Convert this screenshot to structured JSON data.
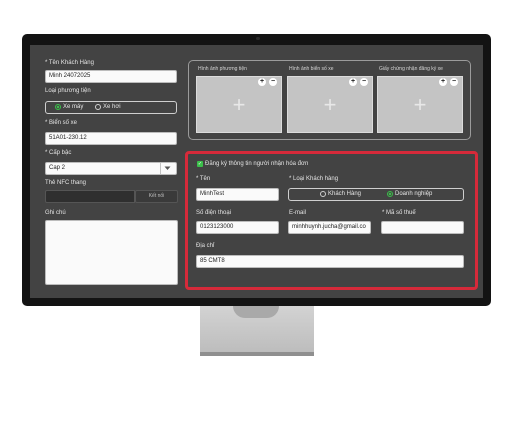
{
  "customer": {
    "name_label": "* Tên Khách Hàng",
    "name_value": "Minh 24072025",
    "vehicle_type_label": "Loại phương tiện",
    "vehicle_options": [
      {
        "label": "Xe máy",
        "selected": true
      },
      {
        "label": "Xe hơi",
        "selected": false
      }
    ],
    "plate_label": "* Biển số xe",
    "plate_value": "51A01-230.12",
    "level_label": "* Cấp bậc",
    "level_value": "Cap 2",
    "nfc_label": "Thẻ NFC thang",
    "connect_label": "Kết nối",
    "notes_label": "Ghi chú"
  },
  "images": [
    {
      "title": "Hình ảnh phương tiện"
    },
    {
      "title": "Hình ảnh biển số xe"
    },
    {
      "title": "Giấy chứng nhận đăng ký xe"
    }
  ],
  "image_controls": {
    "add": "+",
    "remove": "−",
    "placeholder": "+"
  },
  "invoice": {
    "checkbox_label": "Đăng ký thông tin người nhận hóa đơn",
    "checked": true,
    "name_label": "* Tên",
    "name_value": "MinhTest",
    "customer_type_label": "* Loại Khách hàng",
    "customer_type_options": [
      {
        "label": "Khách Hàng",
        "selected": false
      },
      {
        "label": "Doanh nghiệp",
        "selected": true
      }
    ],
    "phone_label": "Số điện thoại",
    "phone_value": "0123123000",
    "email_label": "E-mail",
    "email_value": "minhhuynh.jucha@gmail.co",
    "tax_label": "* Mã số thuế",
    "tax_value": "",
    "address_label": "Địa chỉ",
    "address_value": "85 CMT8"
  },
  "colors": {
    "highlight": "#d62a3a",
    "accent": "#3bbf4a",
    "screen": "#434343"
  },
  "icons": {
    "dropdown": "chevron-down-icon",
    "add": "plus-icon",
    "remove": "minus-icon",
    "check": "check-icon"
  }
}
